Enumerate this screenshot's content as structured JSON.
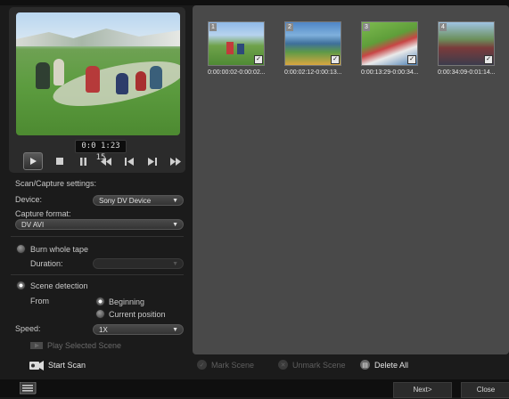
{
  "preview": {
    "timecode": "0:0 1:23 15",
    "controls": [
      "play-icon",
      "stop-icon",
      "pause-icon",
      "rewind-icon",
      "previous-frame-icon",
      "next-frame-icon",
      "fast-forward-icon"
    ]
  },
  "settings": {
    "section_title": "Scan/Capture settings:",
    "device_label": "Device:",
    "device_value": "Sony DV Device",
    "format_label": "Capture format:",
    "format_value": "DV AVI",
    "burn_label": "Burn whole tape",
    "duration_label": "Duration:",
    "duration_value": "",
    "scene_detection_label": "Scene detection",
    "from_label": "From",
    "beginning_label": "Beginning",
    "current_position_label": "Current position",
    "speed_label": "Speed:",
    "speed_value": "1X",
    "play_selected_label": "Play Selected Scene",
    "start_scan_label": "Start Scan"
  },
  "scenes": [
    {
      "number": "1",
      "caption": "0:00:00:02-0:00:02..."
    },
    {
      "number": "2",
      "caption": "0:00:02:12-0:00:13..."
    },
    {
      "number": "3",
      "caption": "0:00:13:29-0:00:34..."
    },
    {
      "number": "4",
      "caption": "0:00:34:09-0:01:14..."
    }
  ],
  "scene_actions": {
    "mark": "Mark Scene",
    "unmark": "Unmark Scene",
    "delete_all": "Delete All"
  },
  "footer": {
    "next": "Next>",
    "close": "Close"
  },
  "colors": {
    "panel_bg": "#494949",
    "window_bg": "#1b1b1b",
    "footer_bg": "#0f0f0f"
  }
}
